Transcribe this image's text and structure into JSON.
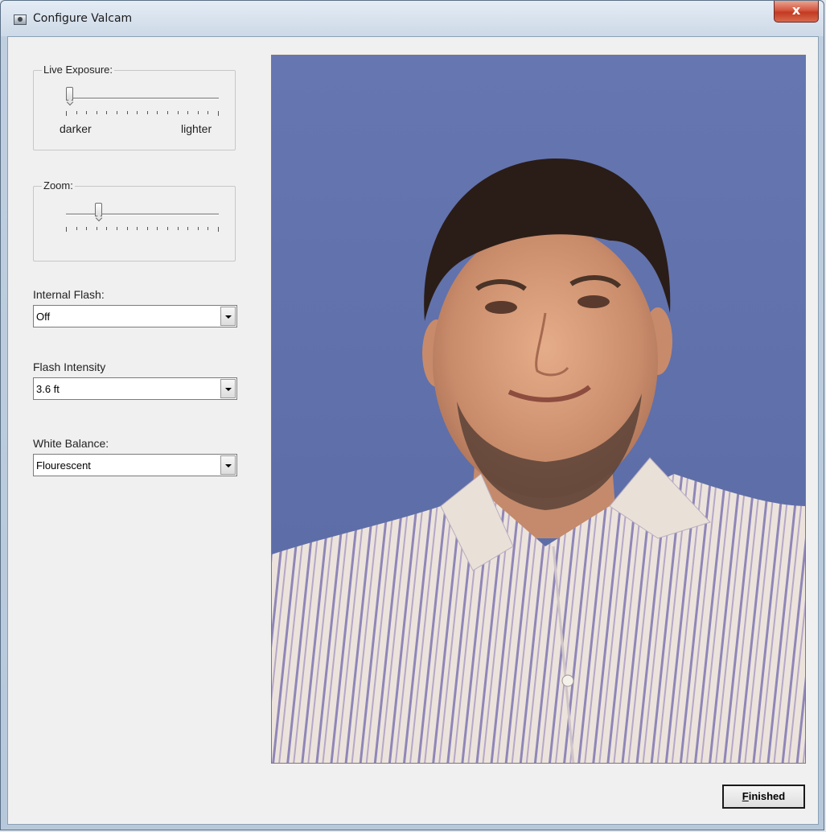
{
  "window": {
    "title": "Configure Valcam",
    "close_glyph": "x"
  },
  "live_exposure": {
    "label": "Live Exposure:",
    "min_caption": "darker",
    "max_caption": "lighter",
    "value_fraction": 0.0
  },
  "zoom": {
    "label": "Zoom:",
    "value_fraction": 0.2
  },
  "internal_flash": {
    "label": "Internal Flash:",
    "value": "Off"
  },
  "flash_intensity": {
    "label": "Flash Intensity",
    "value": "3.6 ft"
  },
  "white_balance": {
    "label": "White Balance:",
    "value": "Flourescent"
  },
  "preview": {
    "background_color": "#5e6fa8",
    "subject": "person-portrait-image"
  },
  "finished_button": {
    "accel": "F",
    "rest": "inished"
  },
  "icons": {
    "title_icon": "camera-icon",
    "dropdown_icon": "chevron-down-icon"
  }
}
